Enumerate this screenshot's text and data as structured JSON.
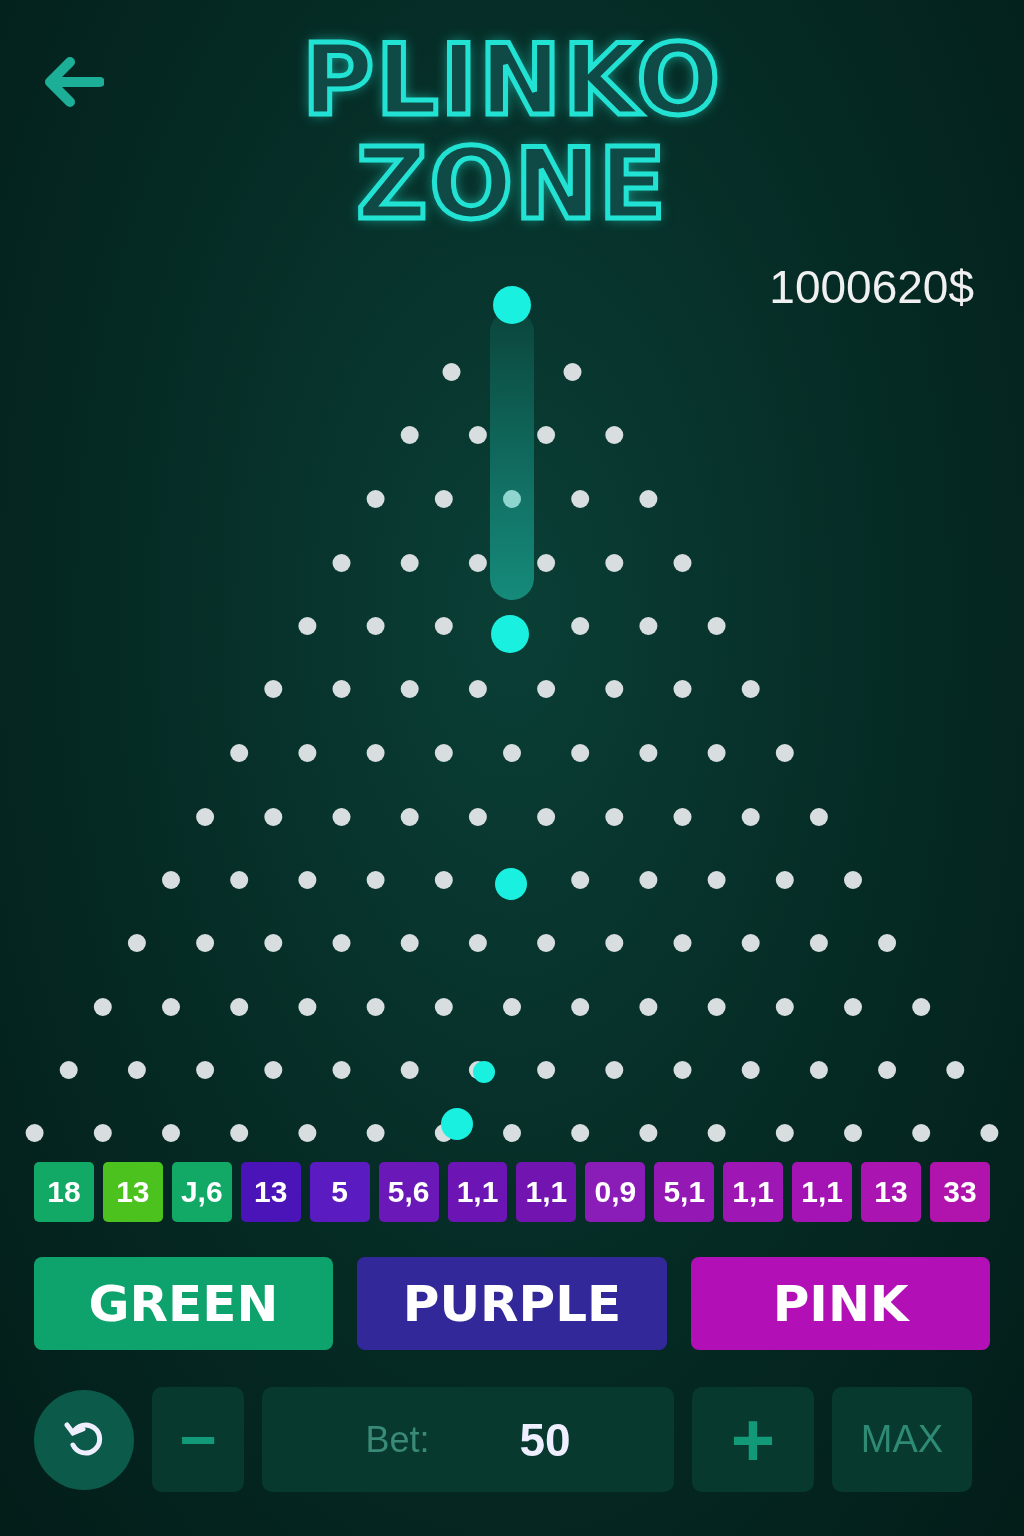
{
  "header": {
    "title_lines": [
      "PLINKO",
      "ZONE"
    ]
  },
  "balance": "1000620$",
  "multipliers": [
    {
      "label": "18",
      "color": "#12a866"
    },
    {
      "label": "13",
      "color": "#4cc21e"
    },
    {
      "label": "J,6",
      "color": "#12a866"
    },
    {
      "label": "13",
      "color": "#4a14b8"
    },
    {
      "label": "5",
      "color": "#5a1cc0"
    },
    {
      "label": "5,6",
      "color": "#6a18b8"
    },
    {
      "label": "1,1",
      "color": "#6c14b4"
    },
    {
      "label": "1,1",
      "color": "#7214b0"
    },
    {
      "label": "0,9",
      "color": "#8a1cb8"
    },
    {
      "label": "5,1",
      "color": "#9418b4"
    },
    {
      "label": "1,1",
      "color": "#9e16b4"
    },
    {
      "label": "1,1",
      "color": "#a414b4"
    },
    {
      "label": "13",
      "color": "#aa14b0"
    },
    {
      "label": "33",
      "color": "#b014ac"
    }
  ],
  "color_buttons": [
    {
      "label": "GREEN",
      "color": "#0ea36c"
    },
    {
      "label": "PURPLE",
      "color": "#33289a"
    },
    {
      "label": "PINK",
      "color": "#b20fb6"
    }
  ],
  "controls": {
    "minus": "−",
    "bet_label": "Bet:",
    "bet_value": "50",
    "plus": "+",
    "max": "MAX"
  }
}
